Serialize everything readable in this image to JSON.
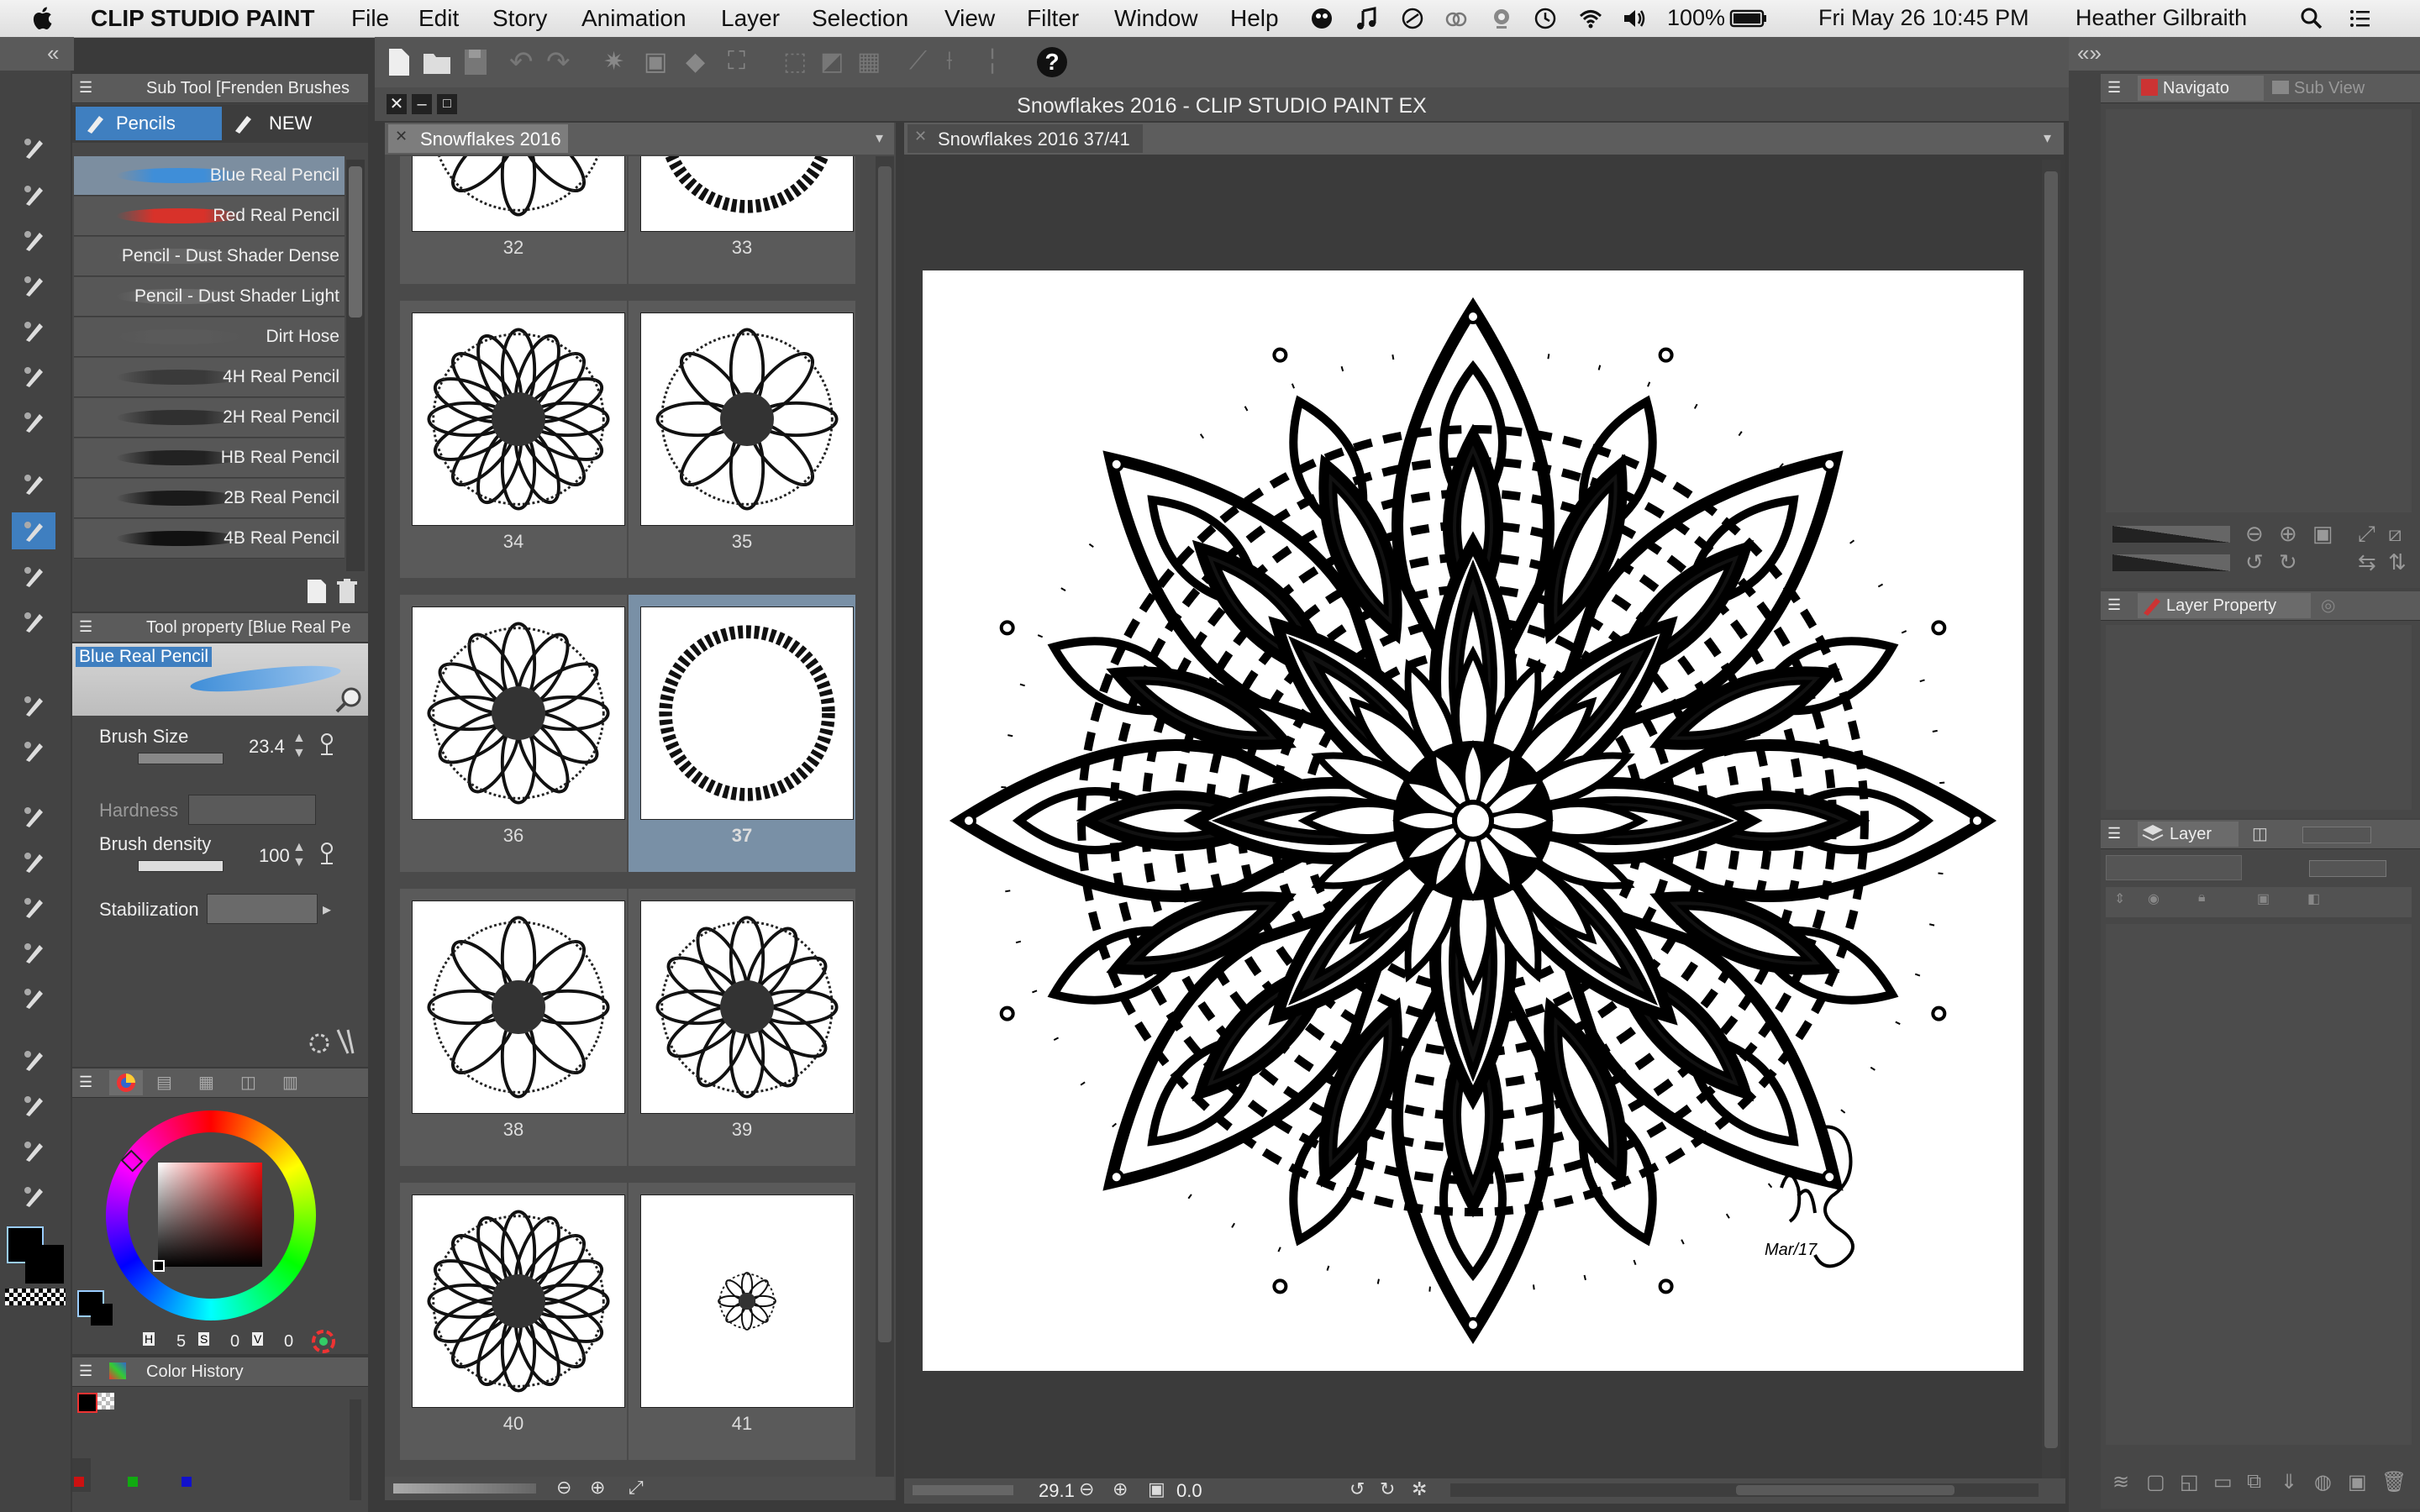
{
  "menubar": {
    "app_name": "CLIP STUDIO PAINT",
    "menus": [
      "File",
      "Edit",
      "Story",
      "Animation",
      "Layer",
      "Selection",
      "View",
      "Filter",
      "Window",
      "Help"
    ],
    "battery": "100%",
    "datetime": "Fri May 26  10:45 PM",
    "user": "Heather Gilbraith"
  },
  "window": {
    "title": "Snowflakes 2016 - CLIP STUDIO PAINT EX"
  },
  "subtool": {
    "header": "Sub Tool [Frenden Brushes",
    "tabs": [
      "Pencils",
      "NEW"
    ],
    "brushes": [
      {
        "label": "Blue Real Pencil",
        "color": "#3f8ed8"
      },
      {
        "label": "Red Real Pencil",
        "color": "#d8322a"
      },
      {
        "label": "Pencil - Dust Shader Dense",
        "color": "#666666"
      },
      {
        "label": "Pencil - Dust Shader Light",
        "color": "#6a6a6a"
      },
      {
        "label": "Dirt Hose",
        "color": "#5a5a5a"
      },
      {
        "label": "4H Real Pencil",
        "color": "#3a3a3a"
      },
      {
        "label": "2H Real Pencil",
        "color": "#303030"
      },
      {
        "label": "HB Real Pencil",
        "color": "#222222"
      },
      {
        "label": "2B Real Pencil",
        "color": "#1a1a1a"
      },
      {
        "label": "4B Real Pencil",
        "color": "#111111"
      }
    ]
  },
  "toolprop": {
    "header": "Tool property [Blue Real Pe",
    "preview_label": "Blue Real Pencil",
    "brush_size_label": "Brush Size",
    "brush_size_value": "23.4",
    "hardness_label": "Hardness",
    "density_label": "Brush density",
    "density_value": "100",
    "stabilization_label": "Stabilization"
  },
  "color": {
    "h_label": "H",
    "h_val": "5",
    "s_label": "S",
    "s_val": "0",
    "v_label": "V",
    "v_val": "0",
    "history_label": "Color History"
  },
  "pages": {
    "tab": "Snowflakes 2016",
    "cards": [
      "32",
      "33",
      "34",
      "35",
      "36",
      "37",
      "38",
      "39",
      "40",
      "41"
    ],
    "selected": "37"
  },
  "canvas": {
    "tab": "Snowflakes 2016 37/41",
    "zoom": "29.1",
    "angle": "0.0",
    "signature_date": "Mar/17"
  },
  "right": {
    "navigator_tab": "Navigato",
    "subview_tab": "Sub View",
    "layerprop_tab": "Layer Property",
    "layer_tab": "Layer"
  }
}
